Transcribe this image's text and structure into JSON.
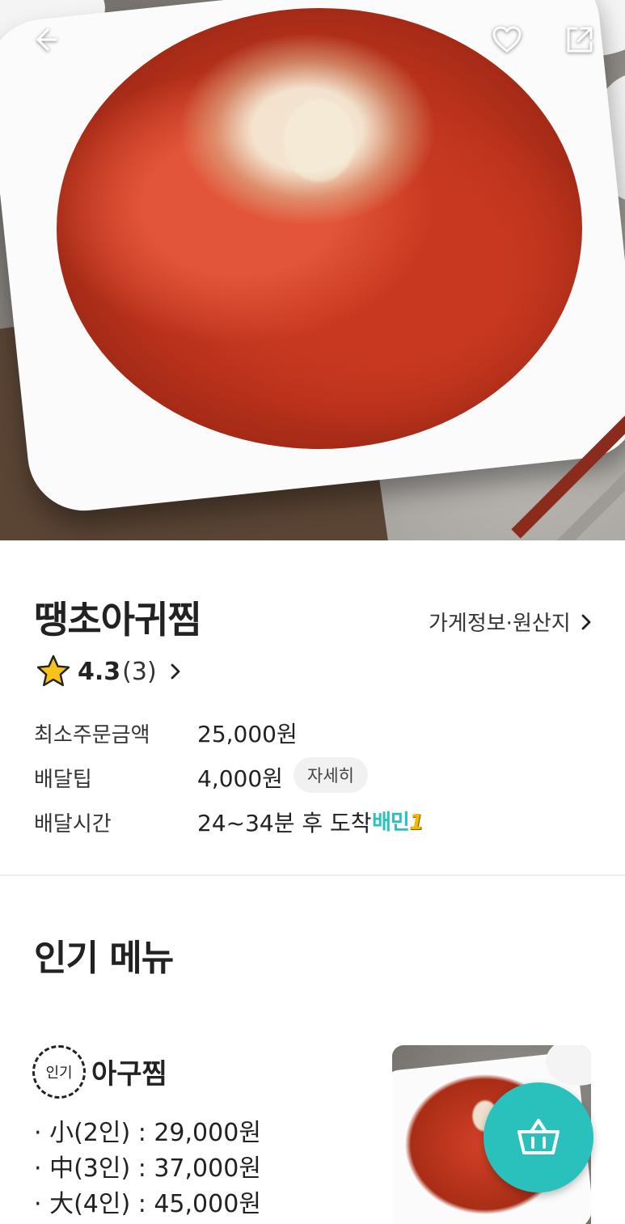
{
  "header": {
    "back_icon": "arrow-left-icon",
    "favorite_icon": "heart-outline-icon",
    "share_icon": "share-external-icon"
  },
  "store": {
    "name": "땡초아귀찜",
    "info_link": "가게정보·원산지",
    "rating": "4.3",
    "review_count": "(3)",
    "info_rows": [
      {
        "label": "최소주문금액",
        "value": "25,000원"
      },
      {
        "label": "배달팁",
        "value": "4,000원"
      },
      {
        "label": "배달시간",
        "value": "24~34분 후 도착"
      }
    ],
    "delivery_tip_detail": "자세히",
    "service_badge": "배민",
    "service_badge_num": "1"
  },
  "popular": {
    "title": "인기 메뉴",
    "items": [
      {
        "badge": "인기",
        "name": "아구찜",
        "options": [
          "· 小(2인) : 29,000원",
          "· 中(3인) : 37,000원",
          "· 大(4인) : 45,000원"
        ]
      }
    ]
  },
  "colors": {
    "accent": "#2ac1bc",
    "star": "#f7c21a",
    "badge_one": "#f2b705"
  },
  "cart_icon": "shopping-basket-icon"
}
